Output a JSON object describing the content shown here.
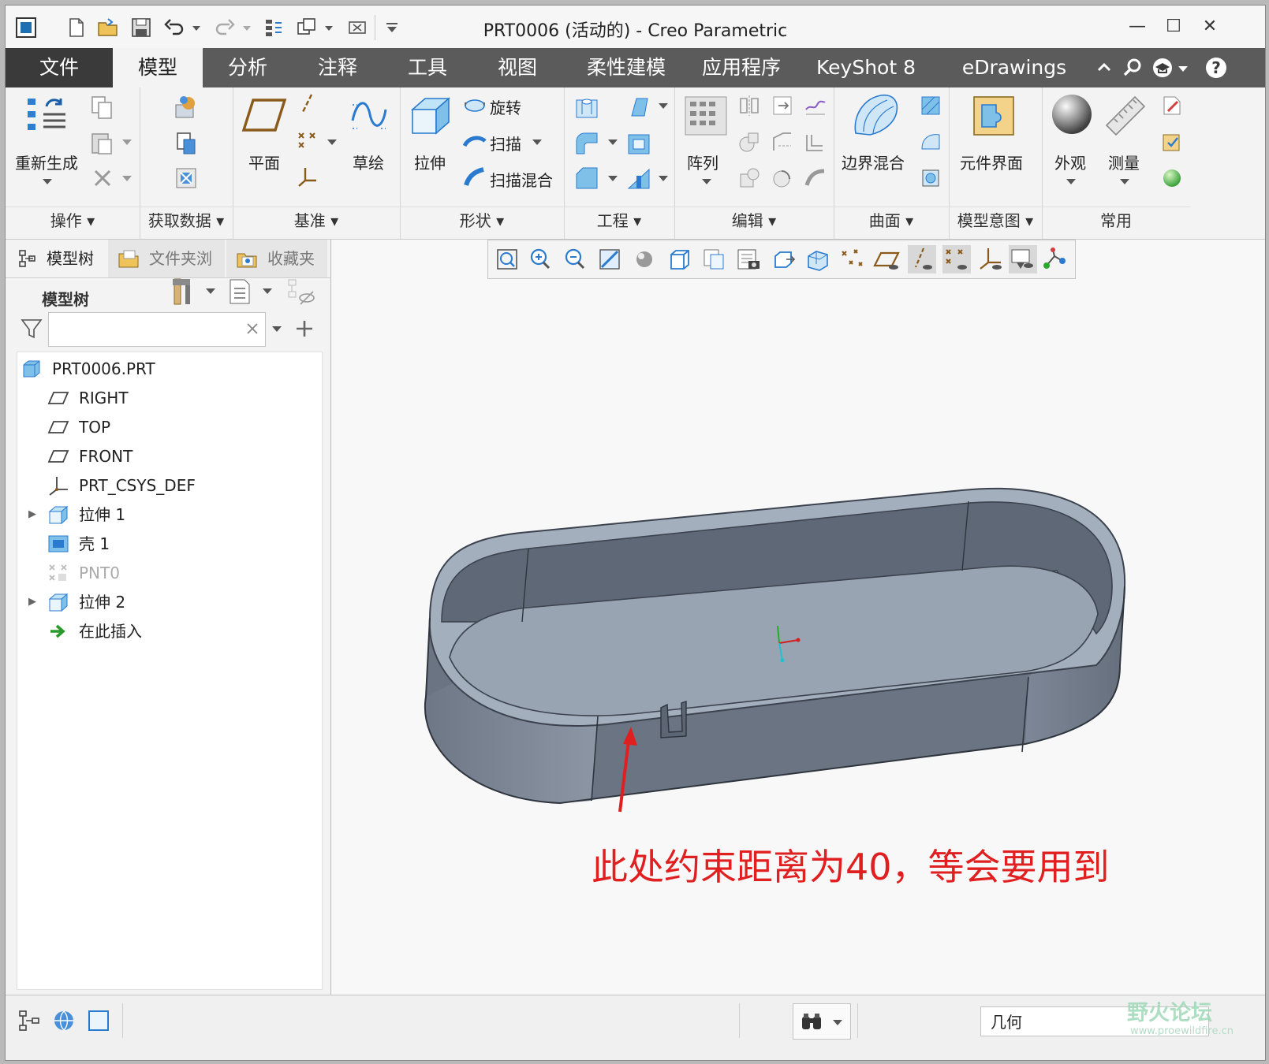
{
  "window": {
    "title": "PRT0006 (活动的) - Creo Parametric",
    "minimize": "—",
    "maximize": "☐",
    "close": "✕"
  },
  "tabs": [
    "文件",
    "模型",
    "分析",
    "注释",
    "工具",
    "视图",
    "柔性建模",
    "应用程序",
    "KeyShot 8",
    "eDrawings"
  ],
  "active_tab": "模型",
  "ribbon": {
    "ops": {
      "label": "操作",
      "regenerate": "重新生成"
    },
    "getdata": {
      "label": "获取数据"
    },
    "datum": {
      "label": "基准",
      "plane": "平面",
      "sketch": "草绘"
    },
    "shapes": {
      "label": "形状",
      "extrude": "拉伸",
      "revolve": "旋转",
      "sweep": "扫描",
      "swept_blend": "扫描混合"
    },
    "engineering": {
      "label": "工程"
    },
    "editing": {
      "label": "编辑",
      "pattern": "阵列"
    },
    "surfaces": {
      "label": "曲面",
      "boundary_blend": "边界混合"
    },
    "intent": {
      "label": "模型意图",
      "component_interface": "元件界面"
    },
    "common": {
      "label": "常用",
      "appearance": "外观",
      "measure": "测量"
    }
  },
  "panel": {
    "tabs": [
      "模型树",
      "文件夹浏",
      "收藏夹"
    ],
    "tree_header": "模型树",
    "filter_placeholder": "",
    "tree": [
      {
        "label": "PRT0006.PRT",
        "icon": "part-icon",
        "expandable": false,
        "level": 0
      },
      {
        "label": "RIGHT",
        "icon": "datum-plane-icon",
        "expandable": false,
        "level": 1
      },
      {
        "label": "TOP",
        "icon": "datum-plane-icon",
        "expandable": false,
        "level": 1
      },
      {
        "label": "FRONT",
        "icon": "datum-plane-icon",
        "expandable": false,
        "level": 1
      },
      {
        "label": "PRT_CSYS_DEF",
        "icon": "csys-icon",
        "expandable": false,
        "level": 1
      },
      {
        "label": "拉伸 1",
        "icon": "extrude-icon",
        "expandable": true,
        "level": 1
      },
      {
        "label": "壳 1",
        "icon": "shell-icon",
        "expandable": false,
        "level": 1
      },
      {
        "label": "PNT0",
        "icon": "datum-point-icon",
        "expandable": false,
        "level": 1,
        "dimmed": true
      },
      {
        "label": "拉伸 2",
        "icon": "extrude-icon",
        "expandable": true,
        "level": 1
      },
      {
        "label": "在此插入",
        "icon": "insert-here-icon",
        "expandable": false,
        "level": 1
      }
    ]
  },
  "annotation": "此处约束距离为40，等会要用到",
  "status": {
    "selection_filter": "几何",
    "watermark": "野火论坛",
    "watermark_url": "www.proewildfire.cn"
  },
  "colors": {
    "tabbar": "#5b5b5b",
    "file_tab": "#3a3a3a",
    "model_body": "#7b8594",
    "model_floor": "#9aa4b2",
    "annotation": "#e02020"
  }
}
